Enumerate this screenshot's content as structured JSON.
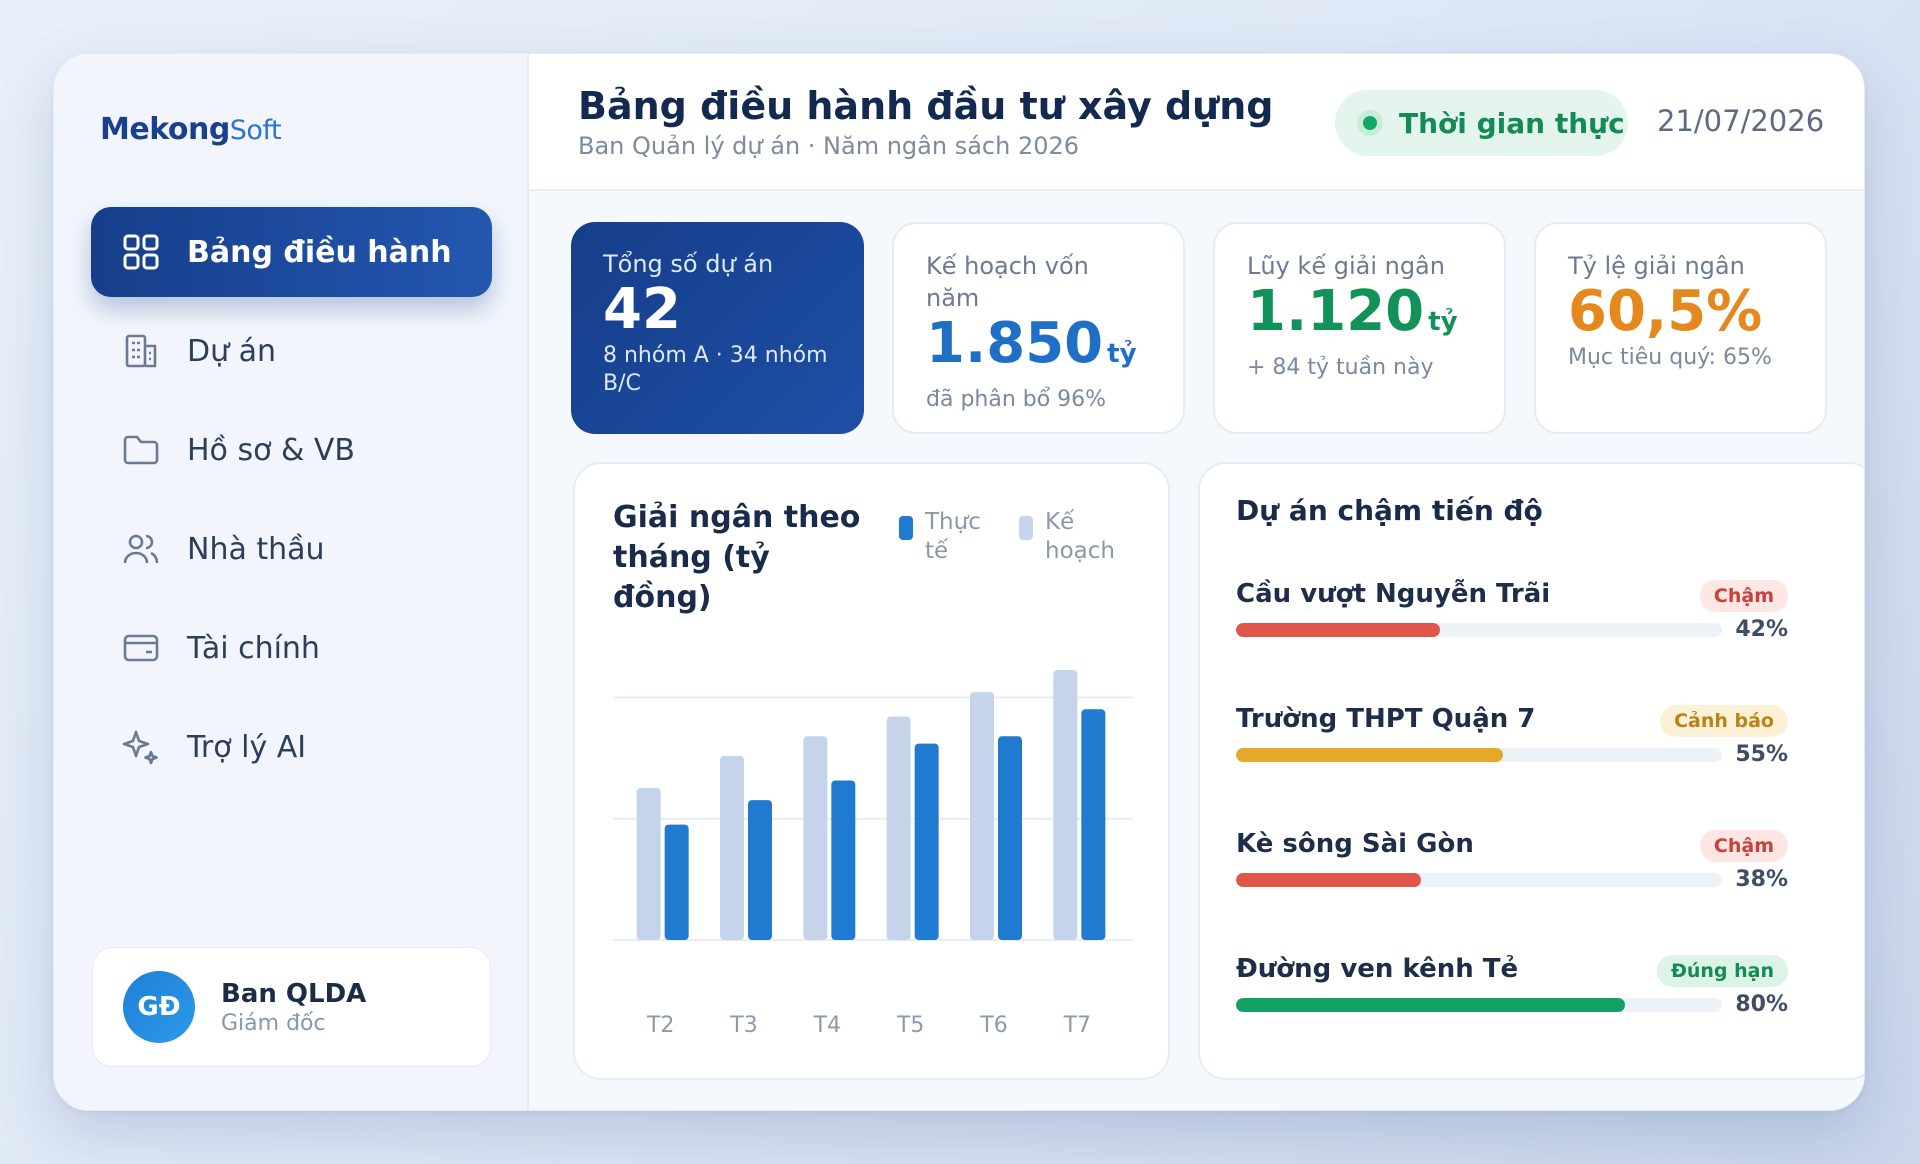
{
  "brand": {
    "name_main": "Mekong",
    "name_soft": "Soft"
  },
  "sidebar": {
    "items": [
      {
        "label": "Bảng điều hành",
        "icon": "dashboard-grid-icon",
        "active": true
      },
      {
        "label": "Dự án",
        "icon": "building-icon",
        "active": false
      },
      {
        "label": "Hồ sơ & VB",
        "icon": "folder-icon",
        "active": false
      },
      {
        "label": "Nhà thầu",
        "icon": "users-icon",
        "active": false
      },
      {
        "label": "Tài chính",
        "icon": "wallet-icon",
        "active": false
      },
      {
        "label": "Trợ lý AI",
        "icon": "sparkle-icon",
        "active": false
      }
    ],
    "user": {
      "initials": "GĐ",
      "name": "Ban QLDA",
      "role": "Giám đốc"
    }
  },
  "header": {
    "title": "Bảng điều hành đầu tư xây dựng",
    "subtitle": "Ban Quản lý dự án · Năm ngân sách 2026",
    "live_label": "Thời gian thực",
    "date": "21/07/2026"
  },
  "kpis": [
    {
      "label": "Tổng số dự án",
      "value": "42",
      "unit": "",
      "foot": "8 nhóm A · 34 nhóm B/C",
      "color": "#ffffff"
    },
    {
      "label": "Kế hoạch vốn năm",
      "value": "1.850",
      "unit": "tỷ",
      "foot": "đã phân bổ 96%",
      "color": "#1f6fc6"
    },
    {
      "label": "Lũy kế giải ngân",
      "value": "1.120",
      "unit": "tỷ",
      "foot": "+ 84 tỷ tuần này",
      "color": "#129158"
    },
    {
      "label": "Tỷ lệ giải ngân",
      "value": "60,5%",
      "unit": "",
      "foot": "Mục tiêu quý: 65%",
      "color": "#e5891f"
    }
  ],
  "chart_data": {
    "type": "bar",
    "title": "Giải ngân theo tháng (tỷ đồng)",
    "categories": [
      "T2",
      "T3",
      "T4",
      "T5",
      "T6",
      "T7"
    ],
    "series": [
      {
        "name": "Kế hoạch",
        "values": [
          62,
          75,
          83,
          91,
          101,
          110
        ],
        "color": "#c5d4ea"
      },
      {
        "name": "Thực tế",
        "values": [
          47,
          57,
          65,
          80,
          83,
          94
        ],
        "color": "#1f7ad0"
      }
    ],
    "ylim": [
      0,
      110
    ],
    "grid": true,
    "legend": "top-right"
  },
  "late_projects": {
    "title": "Dự án chậm tiến độ",
    "items": [
      {
        "name": "Cầu vượt Nguyễn Trãi",
        "status": "Chậm",
        "progress": 42,
        "pct_label": "42%",
        "bar_color": "#e0564a",
        "badge_bg": "#fde6e4",
        "badge_fg": "#c8413a"
      },
      {
        "name": "Trường THPT Quận 7",
        "status": "Cảnh báo",
        "progress": 55,
        "pct_label": "55%",
        "bar_color": "#e4a92a",
        "badge_bg": "#fcf1d6",
        "badge_fg": "#b98416"
      },
      {
        "name": "Kè sông Sài Gòn",
        "status": "Chậm",
        "progress": 38,
        "pct_label": "38%",
        "bar_color": "#e0564a",
        "badge_bg": "#fde6e4",
        "badge_fg": "#c8413a"
      },
      {
        "name": "Đường ven kênh Tẻ",
        "status": "Đúng hạn",
        "progress": 80,
        "pct_label": "80%",
        "bar_color": "#14a264",
        "badge_bg": "#dcf4e8",
        "badge_fg": "#148a55"
      }
    ]
  }
}
